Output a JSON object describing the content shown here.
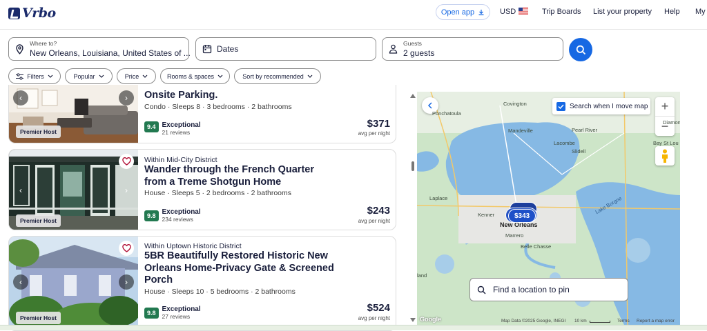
{
  "header": {
    "logo_text": "Vrbo",
    "open_app": "Open app",
    "currency": "USD",
    "trip_boards": "Trip Boards",
    "list_property": "List your property",
    "help": "Help",
    "my": "My"
  },
  "search": {
    "where_label": "Where to?",
    "where_value": "New Orleans, Louisiana, United States of ...",
    "dates_value": "Dates",
    "guests_label": "Guests",
    "guests_value": "2 guests"
  },
  "filters": [
    "Filters",
    "Popular",
    "Price",
    "Rooms & spaces",
    "Sort by recommended"
  ],
  "listings": [
    {
      "title": "Onsite Parking.",
      "meta": "Condo · Sleeps 8 · 3 bedrooms · 2 bathrooms",
      "rating": "9.4",
      "rating_word": "Exceptional",
      "reviews": "21 reviews",
      "price": "$371",
      "per": "avg per night",
      "badge": "Premier Host"
    },
    {
      "district": "Within Mid-City District",
      "title_line1": "Wander through the French Quarter",
      "title_line2": "from a Treme Shotgun Home",
      "meta": "House · Sleeps 5 · 2 bedrooms · 2 bathrooms",
      "rating": "9.8",
      "rating_word": "Exceptional",
      "reviews": "234 reviews",
      "price": "$243",
      "per": "avg per night",
      "badge": "Premier Host"
    },
    {
      "district": "Within Uptown Historic District",
      "title_line1": "5BR Beautifully Restored Historic New",
      "title_line2": "Orleans Home-Privacy Gate & Screened",
      "title_line3": "Porch",
      "meta": "House · Sleeps 10 · 5 bedrooms · 2 bathrooms",
      "rating": "9.8",
      "rating_word": "Exceptional",
      "reviews": "27 reviews",
      "price": "$524",
      "per": "avg per night",
      "badge": "Premier Host"
    }
  ],
  "map": {
    "search_when_move": "Search when I move map",
    "find_location": "Find a location to pin",
    "cluster_price": "$343",
    "towns": {
      "ponchatoula": "Ponchatoula",
      "covington": "Covington",
      "mandeville": "Mandeville",
      "lacombe": "Lacombe",
      "slidell": "Slidell",
      "pearl_river": "Pearl River",
      "diamondhead": "Diamondhead",
      "bay_st_louis": "Bay St Lou",
      "laplace": "Laplace",
      "kenner": "Kenner",
      "new_orleans": "New Orleans",
      "marrero": "Marrero",
      "belle_chasse": "Belle Chasse",
      "lake_borgne": "Lake Borgne",
      "island": "land"
    },
    "google": "Google",
    "attribution": "Map Data ©2025 Google, INEGI",
    "scale": "10 km",
    "terms": "Terms",
    "report": "Report a map error"
  },
  "colors": {
    "brand": "#1b2b6b",
    "accent": "#1668e3",
    "rating": "#227950"
  }
}
